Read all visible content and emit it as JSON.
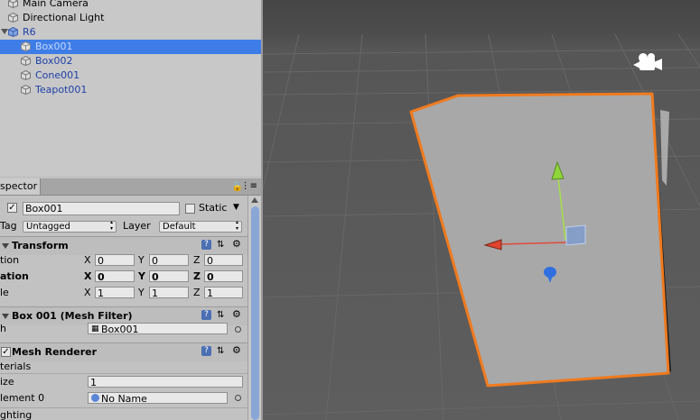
{
  "hierarchy": {
    "items": [
      {
        "label": "Main Camera"
      },
      {
        "label": "Directional Light"
      },
      {
        "label": "R6"
      },
      {
        "label": "Box001"
      },
      {
        "label": "Box002"
      },
      {
        "label": "Cone001"
      },
      {
        "label": "Teapot001"
      }
    ]
  },
  "inspector": {
    "tab_label": "spector",
    "object_name": "Box001",
    "static_label": "Static",
    "tag_label": "Tag",
    "tag_value": "Untagged",
    "layer_label": "Layer",
    "layer_value": "Default",
    "transform": {
      "title": "Transform",
      "rows": [
        {
          "label": "tion",
          "x": "0",
          "y": "0",
          "z": "0"
        },
        {
          "label": "ation",
          "x": "0",
          "y": "0",
          "z": "0"
        },
        {
          "label": "le",
          "x": "1",
          "y": "1",
          "z": "1"
        }
      ],
      "axis_x": "X",
      "axis_y": "Y",
      "axis_z": "Z"
    },
    "mesh_filter": {
      "title": "Box 001 (Mesh Filter)",
      "label": "h",
      "mesh_value": "Box001"
    },
    "mesh_renderer": {
      "title": "Mesh Renderer",
      "materials_label": "terials",
      "size_label": "ize",
      "size_value": "1",
      "element_label": "lement 0",
      "element_value": "No Name",
      "lighting_label": "ghting"
    }
  },
  "colors": {
    "selection": "#3e7de7",
    "prefab_text": "#1e3fa8",
    "selection_outline": "#f07a1e",
    "scene_bg": "#585858"
  }
}
